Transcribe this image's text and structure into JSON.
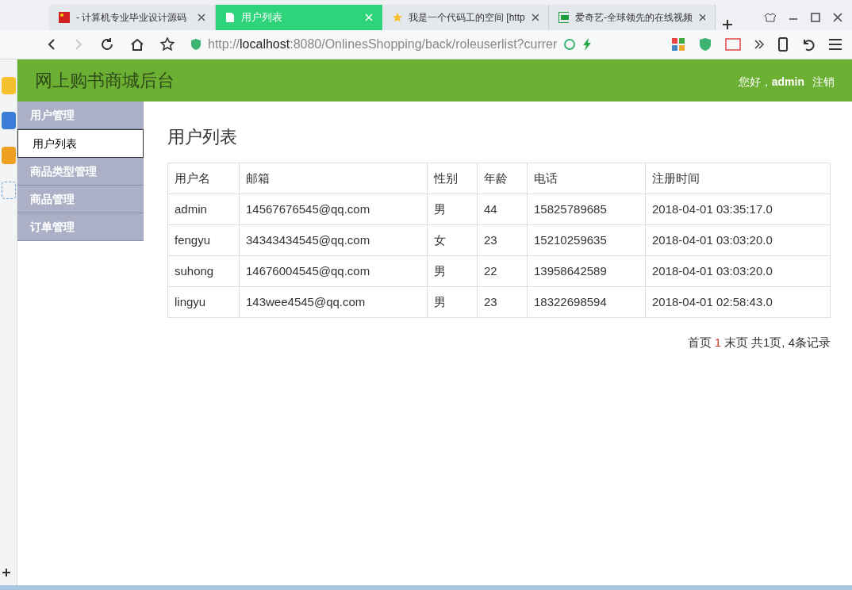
{
  "browser": {
    "tabs": [
      {
        "title": "- 计算机专业毕业设计源码",
        "selected": false,
        "kind": "flag"
      },
      {
        "title": "用户列表",
        "selected": true,
        "kind": "page"
      },
      {
        "title": "我是一个代码工的空间 [http",
        "selected": false,
        "kind": "star"
      },
      {
        "title": "爱奇艺-全球领先的在线视频",
        "selected": false,
        "kind": "video"
      }
    ],
    "url": "http://**localhost**:8080/OnlinesShopping/back/roleuserlist?currer"
  },
  "header": {
    "title": "网上购书商城后台",
    "greeting": "您好，",
    "user": "admin",
    "logout": "注销"
  },
  "sidebar": {
    "items": [
      {
        "kind": "group",
        "label": "用户管理",
        "selected": false
      },
      {
        "kind": "item",
        "label": "用户列表",
        "selected": true
      },
      {
        "kind": "group",
        "label": "商品类型管理",
        "selected": false
      },
      {
        "kind": "group",
        "label": "商品管理",
        "selected": false
      },
      {
        "kind": "group",
        "label": "订单管理",
        "selected": false
      }
    ]
  },
  "page_title": "用户列表",
  "table": {
    "columns": [
      "用户名",
      "邮箱",
      "性别",
      "年龄",
      "电话",
      "注册时间"
    ],
    "rows": [
      [
        "admin",
        "14567676545@qq.com",
        "男",
        "44",
        "15825789685",
        "2018-04-01 03:35:17.0"
      ],
      [
        "fengyu",
        "34343434545@qq.com",
        "女",
        "23",
        "15210259635",
        "2018-04-01 03:03:20.0"
      ],
      [
        "suhong",
        "14676004545@qq.com",
        "男",
        "22",
        "13958642589",
        "2018-04-01 03:03:20.0"
      ],
      [
        "lingyu",
        "143wee4545@qq.com",
        "男",
        "23",
        "18322698594",
        "2018-04-01 02:58:43.0"
      ]
    ]
  },
  "pagination": {
    "first": "首页",
    "current": "1",
    "last": "末页",
    "summary": "共1页, 4条记录"
  }
}
